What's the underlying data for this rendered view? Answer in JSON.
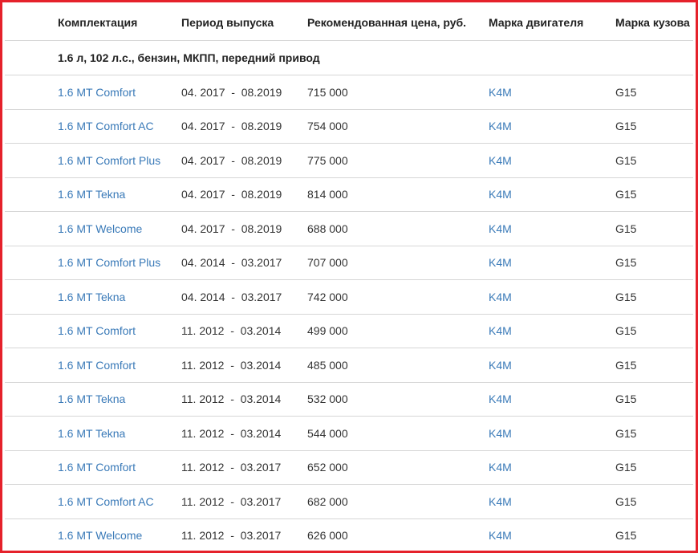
{
  "table": {
    "headers": {
      "trim": "Комплектация",
      "period": "Период выпуска",
      "price": "Рекомендованная цена, руб.",
      "engine": "Марка двигателя",
      "body": "Марка кузова"
    },
    "group": "1.6 л, 102 л.с., бензин, МКПП, передний привод",
    "rows": [
      {
        "trim": "1.6 MT Comfort",
        "period": "04. 2017  -  08.2019",
        "price": "715 000",
        "engine": "K4M",
        "body": "G15"
      },
      {
        "trim": "1.6 MT Comfort AC",
        "period": "04. 2017  -  08.2019",
        "price": "754 000",
        "engine": "K4M",
        "body": "G15"
      },
      {
        "trim": "1.6 MT Comfort Plus",
        "period": "04. 2017  -  08.2019",
        "price": "775 000",
        "engine": "K4M",
        "body": "G15"
      },
      {
        "trim": "1.6 MT Tekna",
        "period": "04. 2017  -  08.2019",
        "price": "814 000",
        "engine": "K4M",
        "body": "G15"
      },
      {
        "trim": "1.6 MT Welcome",
        "period": "04. 2017  -  08.2019",
        "price": "688 000",
        "engine": "K4M",
        "body": "G15"
      },
      {
        "trim": "1.6 MT Comfort Plus",
        "period": "04. 2014  -  03.2017",
        "price": "707 000",
        "engine": "K4M",
        "body": "G15"
      },
      {
        "trim": "1.6 MT Tekna",
        "period": "04. 2014  -  03.2017",
        "price": "742 000",
        "engine": "K4M",
        "body": "G15"
      },
      {
        "trim": "1.6 MT Comfort",
        "period": "11. 2012  -  03.2014",
        "price": "499 000",
        "engine": "K4M",
        "body": "G15"
      },
      {
        "trim": "1.6 MT Comfort",
        "period": "11. 2012  -  03.2014",
        "price": "485 000",
        "engine": "K4M",
        "body": "G15"
      },
      {
        "trim": "1.6 MT Tekna",
        "period": "11. 2012  -  03.2014",
        "price": "532 000",
        "engine": "K4M",
        "body": "G15"
      },
      {
        "trim": "1.6 MT Tekna",
        "period": "11. 2012  -  03.2014",
        "price": "544 000",
        "engine": "K4M",
        "body": "G15"
      },
      {
        "trim": "1.6 MT Comfort",
        "period": "11. 2012  -  03.2017",
        "price": "652 000",
        "engine": "K4M",
        "body": "G15"
      },
      {
        "trim": "1.6 MT Comfort AC",
        "period": "11. 2012  -  03.2017",
        "price": "682 000",
        "engine": "K4M",
        "body": "G15"
      },
      {
        "trim": "1.6 MT Welcome",
        "period": "11. 2012  -  03.2017",
        "price": "626 000",
        "engine": "K4M",
        "body": "G15"
      }
    ]
  },
  "colors": {
    "frame_border": "#e5212b",
    "link": "#3a7ab8",
    "divider": "#d6d6d6",
    "text": "#333333"
  }
}
